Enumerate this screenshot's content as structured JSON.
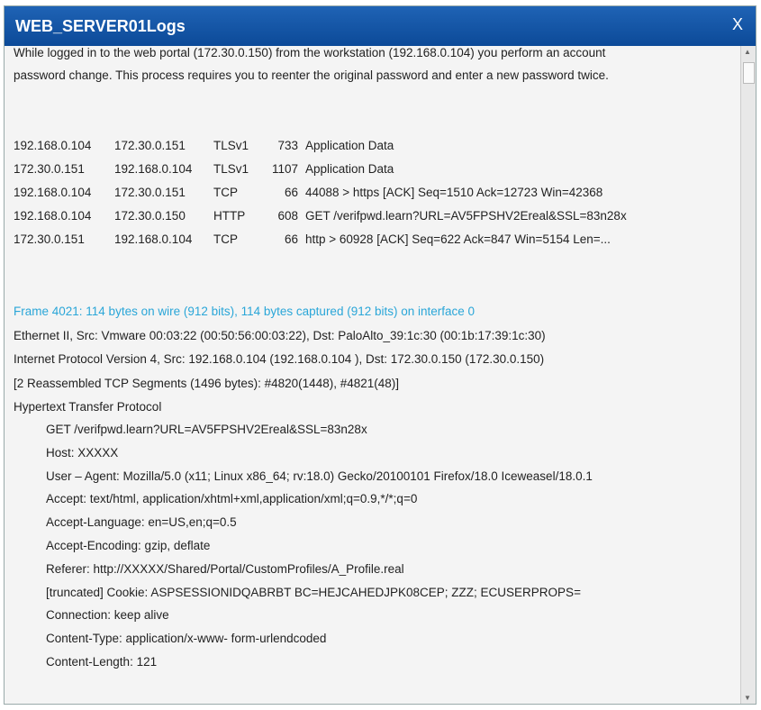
{
  "window": {
    "title": "WEB_SERVER01Logs",
    "close_label": "X"
  },
  "intro": [
    "While logged in to the web portal (172.30.0.150) from the workstation (192.168.0.104) you perform an account",
    "password change.  This process requires you to reenter the original password and enter a new password twice."
  ],
  "packets": [
    [
      "192.168.0.104",
      "172.30.0.151",
      "TLSv1",
      "733",
      "Application Data"
    ],
    [
      "172.30.0.151",
      "192.168.0.104",
      "TLSv1",
      "1107",
      "Application Data"
    ],
    [
      "192.168.0.104",
      "172.30.0.151",
      "TCP",
      "66",
      "44088 > https  [ACK]  Seq=1510 Ack=12723  Win=42368"
    ],
    [
      "192.168.0.104",
      "172.30.0.150",
      "HTTP",
      "608",
      "GET  /verifpwd.learn?URL=AV5FPSHV2Ereal&SSL=83n28x"
    ],
    [
      "172.30.0.151",
      "192.168.0.104",
      "TCP",
      "66",
      "http > 60928  [ACK]  Seq=622  Ack=847  Win=5154  Len=..."
    ]
  ],
  "frame": "Frame  4021:  114 bytes on wire (912 bits), 114 bytes captured (912 bits) on interface 0",
  "details": [
    "Ethernet II, Src:  Vmware 00:03:22  (00:50:56:00:03:22),  Dst:  PaloAlto_39:1c:30  (00:1b:17:39:1c:30)",
    "Internet Protocol Version 4, Src:  192.168.0.104 (192.168.0.104 ), Dst:  172.30.0.150 (172.30.0.150)",
    "[2 Reassembled  TCP  Segments  (1496 bytes):  #4820(1448), #4821(48)]",
    "Hypertext  Transfer  Protocol"
  ],
  "http": [
    "GET  /verifpwd.learn?URL=AV5FPSHV2Ereal&SSL=83n28x",
    "Host:  XXXXX",
    "User – Agent:  Mozilla/5.0  (x11;  Linux  x86_64;  rv:18.0)  Gecko/20100101  Firefox/18.0  Iceweasel/18.0.1",
    "Accept:  text/html, application/xhtml+xml,application/xml;q=0.9,*/*;q=0",
    "Accept-Language:  en=US,en;q=0.5",
    "Accept-Encoding:  gzip,  deflate",
    "Referer:  http://XXXXX/Shared/Portal/CustomProfiles/A_Profile.real",
    "[truncated]  Cookie:  ASPSESSIONIDQABRBT BC=HEJCAHEDJPK08CEP;  ZZZ;  ECUSERPROPS=",
    "Connection:  keep alive",
    "Content-Type:  application/x-www- form-urlendcoded",
    "Content-Length:  121"
  ],
  "colors": {
    "titlebar": "#0c4a98",
    "frame_text": "#2aa6d8"
  }
}
